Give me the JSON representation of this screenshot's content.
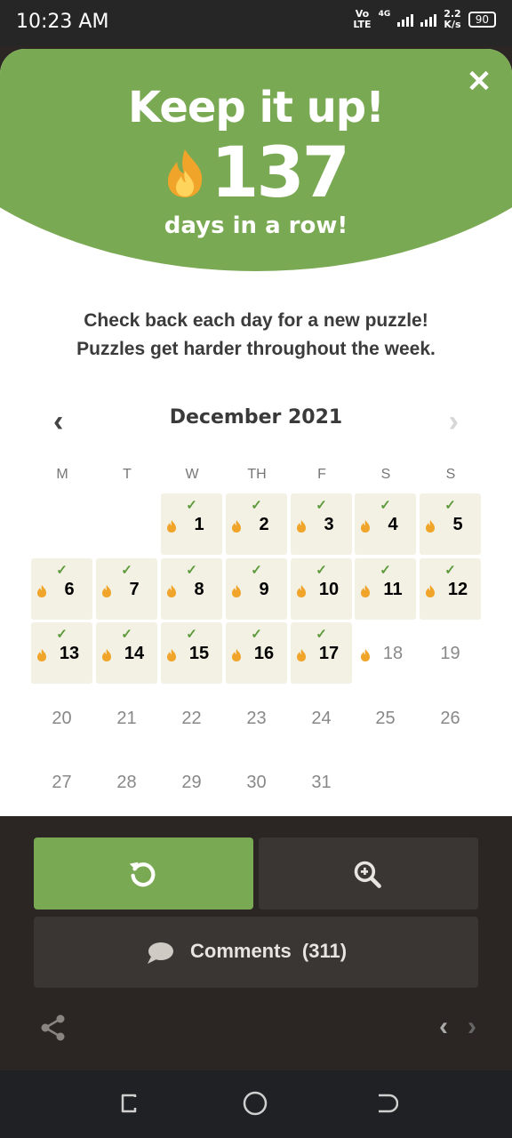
{
  "status_bar": {
    "time": "10:23 AM",
    "network_top": "Vo",
    "network_bottom": "LTE",
    "gen": "4G",
    "speed_top": "2.2",
    "speed_bottom": "K/s",
    "battery": "90"
  },
  "header": {
    "title": "Keep it up!",
    "streak": "137",
    "subtitle": "days in a row!",
    "close_label": "✕"
  },
  "message": {
    "line1": "Check back each day for a new puzzle!",
    "line2": "Puzzles get harder throughout the week."
  },
  "calendar": {
    "month": "December 2021",
    "prev_label": "‹",
    "next_label": "›",
    "weekdays": [
      "M",
      "T",
      "W",
      "TH",
      "F",
      "S",
      "S"
    ],
    "completed_days": 17,
    "flame_only_day": 18
  },
  "bottom": {
    "comments_label": "Comments",
    "comments_count": "(311)"
  },
  "colors": {
    "accent": "#7aa953",
    "check": "#5d9a3b",
    "flame": "#f0a52a",
    "done_cell": "#f3f1e3"
  }
}
